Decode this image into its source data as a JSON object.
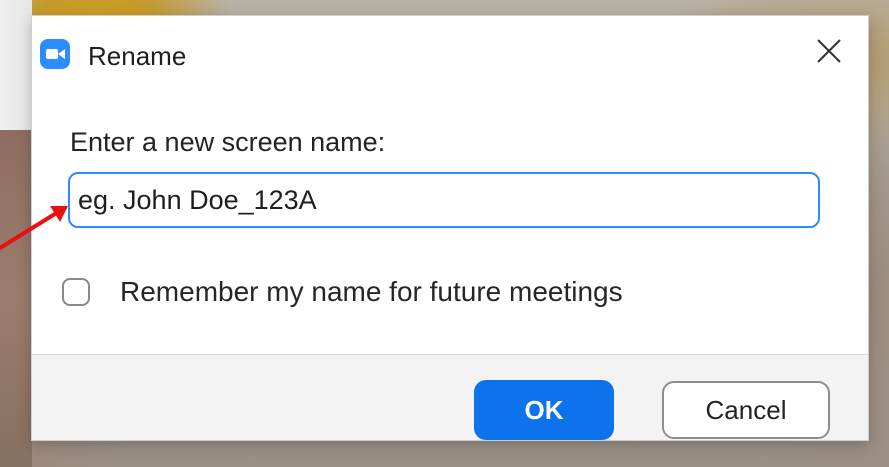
{
  "window": {
    "title": "Rename",
    "app_icon": "video-camera-icon",
    "close_icon": "close-icon"
  },
  "form": {
    "prompt": "Enter a new screen name:",
    "name_value": "eg. John Doe_123A",
    "remember_label": "Remember my name for future meetings",
    "remember_checked": false
  },
  "buttons": {
    "ok": "OK",
    "cancel": "Cancel"
  },
  "colors": {
    "accent": "#2d8cff",
    "ok_button": "#0e72ed",
    "annotation_arrow": "#e81010"
  }
}
